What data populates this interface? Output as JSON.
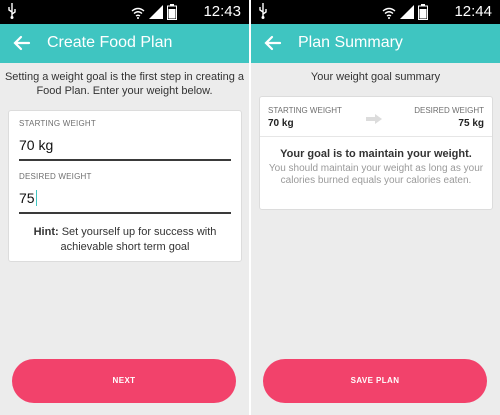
{
  "status_bar": {
    "left_time": "12:43",
    "right_time": "12:44",
    "usb_icon": "usb-icon",
    "wifi_icon": "wifi-icon",
    "signal_icon": "signal-icon",
    "battery_icon": "battery-icon"
  },
  "create_screen": {
    "title": "Create Food Plan",
    "intro": "Setting a weight goal is the first step in creating a Food Plan. Enter your weight below.",
    "starting_label": "STARTING WEIGHT",
    "starting_value": "70 kg",
    "desired_label": "DESIRED WEIGHT",
    "desired_value": "75",
    "hint_bold": "Hint:",
    "hint_text": " Set yourself up for success with achievable short term goal",
    "next_button": "NEXT"
  },
  "summary_screen": {
    "title": "Plan Summary",
    "subtitle": "Your weight goal summary",
    "starting_label": "STARTING WEIGHT",
    "starting_value": "70 kg",
    "desired_label": "DESIRED WEIGHT",
    "desired_value": "75 kg",
    "goal_title": "Your goal is to maintain your weight.",
    "goal_desc": "You should maintain your weight as long as your calories burned equals your calories eaten.",
    "save_button": "SAVE PLAN"
  },
  "colors": {
    "accent": "#3fc5c1",
    "primary_button": "#f2426b",
    "background": "#ececec"
  }
}
